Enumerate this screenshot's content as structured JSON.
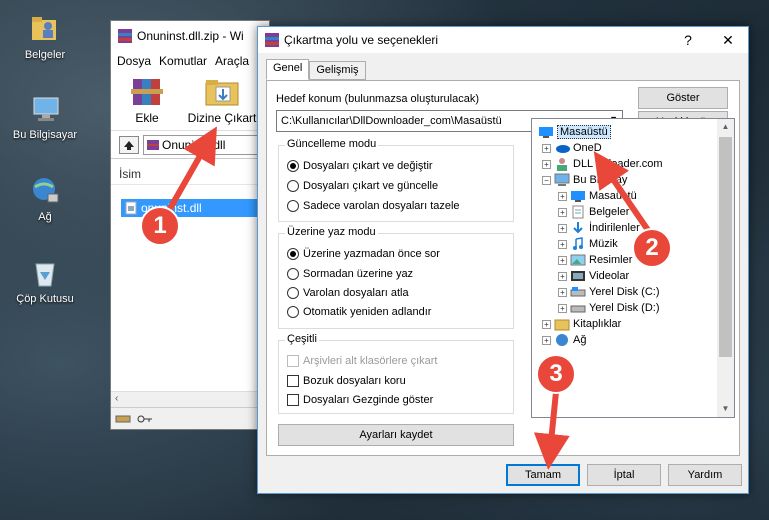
{
  "desktop": {
    "icons": [
      {
        "label": "Belgeler",
        "icon": "documents-folder-icon"
      },
      {
        "label": "Bu Bilgisayar",
        "icon": "computer-icon"
      },
      {
        "label": "Ağ",
        "icon": "network-icon"
      },
      {
        "label": "Çöp Kutusu",
        "icon": "recycle-bin-icon"
      }
    ]
  },
  "winrar": {
    "title": "Onuninst.dll.zip - Wi",
    "menu": [
      "Dosya",
      "Komutlar",
      "Araçla"
    ],
    "toolbar": {
      "add_label": "Ekle",
      "extract_label": "Dizine Çıkart"
    },
    "address": "Onuninst.dll",
    "column_name": "İsim",
    "selected_file": "onuninst.dll"
  },
  "dialog": {
    "title": "Çıkartma yolu ve seçenekleri",
    "help_glyph": "?",
    "close_glyph": "✕",
    "tabs": [
      {
        "label": "Genel"
      },
      {
        "label": "Gelişmiş"
      }
    ],
    "dest_label": "Hedef konum (bulunmazsa oluşturulacak)",
    "dest_value": "C:\\Kullanıcılar\\DllDownloader_com\\Masaüstü",
    "show_button": "Göster",
    "new_folder_button": "Yeni klasör",
    "update_mode": {
      "title": "Güncelleme modu",
      "options": [
        "Dosyaları çıkart ve değiştir",
        "Dosyaları çıkart ve güncelle",
        "Sadece varolan dosyaları tazele"
      ],
      "selected": 0
    },
    "overwrite_mode": {
      "title": "Üzerine yaz modu",
      "options": [
        "Üzerine yazmadan önce sor",
        "Sormadan üzerine yaz",
        "Varolan dosyaları atla",
        "Otomatik yeniden adlandır"
      ],
      "selected": 0
    },
    "misc": {
      "title": "Çeşitli",
      "options": [
        {
          "label": "Arşivleri alt klasörlere çıkart",
          "checked": false,
          "disabled": true
        },
        {
          "label": "Bozuk dosyaları koru",
          "checked": false,
          "disabled": false
        },
        {
          "label": "Dosyaları Gezginde göster",
          "checked": false,
          "disabled": false
        }
      ]
    },
    "save_settings_button": "Ayarları kaydet",
    "tree": [
      {
        "label": "Masaüstü",
        "level": 0,
        "icon": "desktop-icon",
        "selected": true
      },
      {
        "label": "OneD",
        "level": 1,
        "icon": "onedrive-cloud-icon",
        "selected": false
      },
      {
        "label": "DLL D",
        "suffix": "loader.com",
        "level": 1,
        "icon": "user-icon",
        "selected": false
      },
      {
        "label": "Bu Bilgisay",
        "level": 1,
        "icon": "computer-icon",
        "selected": false
      },
      {
        "label": "Masaüstü",
        "level": 2,
        "icon": "desktop-icon",
        "selected": false
      },
      {
        "label": "Belgeler",
        "level": 2,
        "icon": "documents-icon",
        "selected": false
      },
      {
        "label": "İndirilenler",
        "level": 2,
        "icon": "downloads-icon",
        "selected": false
      },
      {
        "label": "Müzik",
        "level": 2,
        "icon": "music-icon",
        "selected": false
      },
      {
        "label": "Resimler",
        "level": 2,
        "icon": "pictures-icon",
        "selected": false
      },
      {
        "label": "Videolar",
        "level": 2,
        "icon": "videos-icon",
        "selected": false
      },
      {
        "label": "Yerel Disk (C:)",
        "level": 2,
        "icon": "drive-icon",
        "selected": false
      },
      {
        "label": "Yerel Disk (D:)",
        "level": 2,
        "icon": "drive-icon",
        "selected": false
      },
      {
        "label": "Kitaplıklar",
        "level": 1,
        "icon": "libraries-icon",
        "selected": false
      },
      {
        "label": "Ağ",
        "level": 1,
        "icon": "network-icon",
        "selected": false
      }
    ],
    "ok_button": "Tamam",
    "cancel_button": "İptal",
    "help_button": "Yardım"
  },
  "markers": [
    "1",
    "2",
    "3"
  ],
  "colors": {
    "accent": "#0078d7",
    "marker": "#e8473a",
    "selection": "#3399ff"
  }
}
